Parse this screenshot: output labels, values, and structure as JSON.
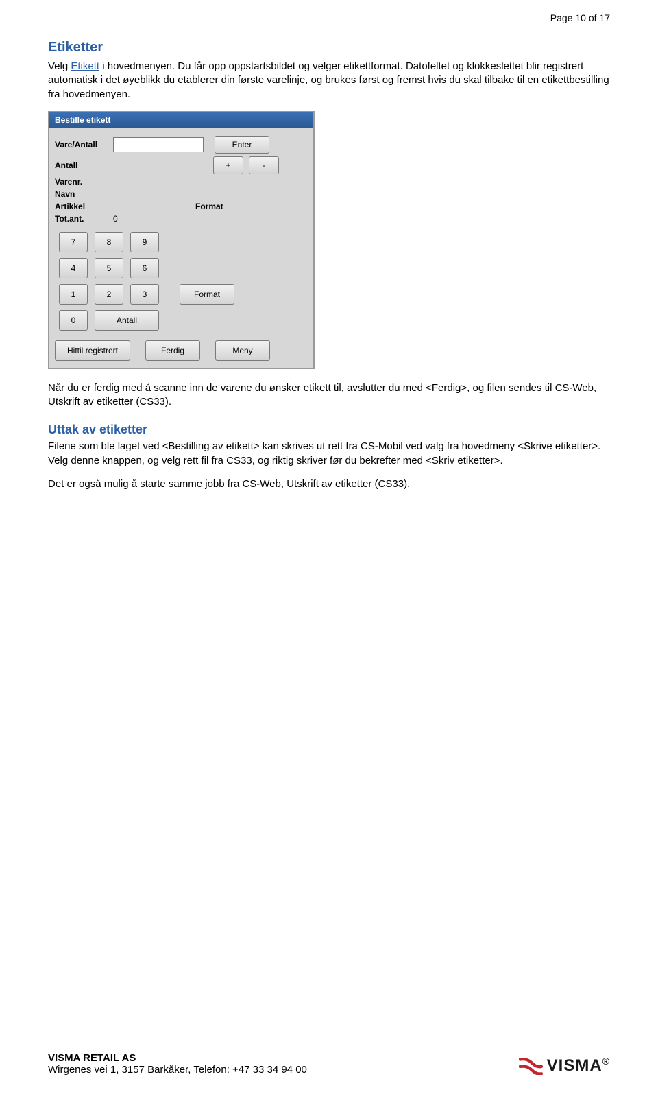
{
  "page_num_prefix": "Page ",
  "page_num": "10",
  "page_of": " of ",
  "page_total": "17",
  "h_etiketter": "Etiketter",
  "p1a": "Velg ",
  "p1b": "Etikett",
  "p1c": " i hovedmenyen. Du får opp oppstartsbildet og velger etikettformat. Datofeltet og klokkeslettet blir registrert automatisk i det øyeblikk du etablerer din første varelinje, og brukes først og fremst hvis du skal tilbake til en etikettbestilling fra hovedmenyen.",
  "shot": {
    "title": "Bestille etikett",
    "vare_antall_lbl": "Vare/Antall",
    "enter_btn": "Enter",
    "antall_lbl": "Antall",
    "plus": "+",
    "minus": "-",
    "varenr_lbl": "Varenr.",
    "navn_lbl": "Navn",
    "artikkel_lbl": "Artikkel",
    "format_lbl": "Format",
    "totant_lbl": "Tot.ant.",
    "totant_val": "0",
    "k7": "7",
    "k8": "8",
    "k9": "9",
    "k4": "4",
    "k5": "5",
    "k6": "6",
    "k1": "1",
    "k2": "2",
    "k3": "3",
    "k0": "0",
    "antall_btn": "Antall",
    "format_btn": "Format",
    "hittil": "Hittil registrert",
    "ferdig": "Ferdig",
    "meny": "Meny"
  },
  "p2": "Når du er ferdig med å scanne inn de varene du ønsker etikett til, avslutter du med <Ferdig>, og filen sendes til CS-Web, Utskrift av etiketter (CS33).",
  "h_uttak": "Uttak av etiketter",
  "p3": "Filene som ble laget ved <Bestilling av etikett> kan skrives ut rett fra CS-Mobil ved valg fra hovedmeny <Skrive etiketter>. Velg denne knappen, og velg rett fil fra CS33, og riktig skriver før du bekrefter med <Skriv etiketter>.",
  "p4": "Det er også mulig å starte samme jobb fra CS-Web, Utskrift av etiketter (CS33).",
  "footer_company": "VISMA RETAIL AS",
  "footer_addr": "Wirgenes vei 1, 3157 Barkåker, Telefon: +47 33 34 94 00",
  "logo_text": "VISMA",
  "logo_reg": "®"
}
